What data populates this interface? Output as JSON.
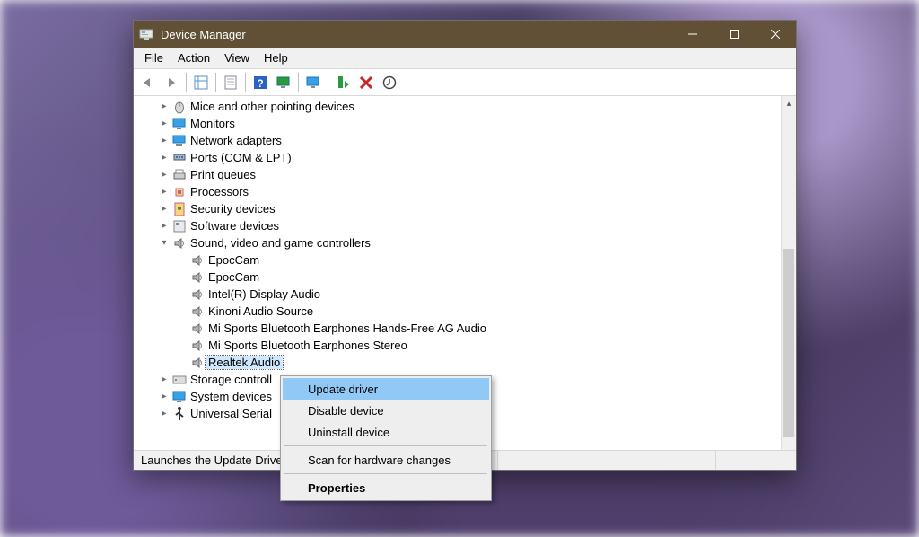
{
  "window": {
    "title": "Device Manager"
  },
  "menubar": [
    "File",
    "Action",
    "View",
    "Help"
  ],
  "toolbar_icons": [
    "back",
    "forward",
    "show-hidden",
    "properties-sheet",
    "help",
    "monitor-scan",
    "monitor-app",
    "enable-device",
    "remove-device",
    "update-driver"
  ],
  "tree": {
    "top_level": [
      {
        "label": "Mice and other pointing devices",
        "icon": "mouse",
        "chev": ">"
      },
      {
        "label": "Monitors",
        "icon": "monitor",
        "chev": ">"
      },
      {
        "label": "Network adapters",
        "icon": "network",
        "chev": ">"
      },
      {
        "label": "Ports (COM & LPT)",
        "icon": "port",
        "chev": ">"
      },
      {
        "label": "Print queues",
        "icon": "printer",
        "chev": ">"
      },
      {
        "label": "Processors",
        "icon": "cpu",
        "chev": ">"
      },
      {
        "label": "Security devices",
        "icon": "security",
        "chev": ">"
      },
      {
        "label": "Software devices",
        "icon": "software",
        "chev": ">"
      },
      {
        "label": "Sound, video and game controllers",
        "icon": "sound",
        "chev": "v",
        "children": [
          "EpocCam",
          "EpocCam",
          "Intel(R) Display Audio",
          "Kinoni Audio Source",
          "Mi Sports Bluetooth Earphones Hands-Free AG Audio",
          "Mi Sports Bluetooth Earphones Stereo",
          "Realtek Audio"
        ],
        "selected_child_index": 6
      },
      {
        "label": "Storage controll",
        "icon": "storage",
        "chev": ">"
      },
      {
        "label": "System devices",
        "icon": "system",
        "chev": ">"
      },
      {
        "label": "Universal Serial",
        "icon": "usb",
        "chev": ">"
      }
    ]
  },
  "context_menu": {
    "items": [
      "Update driver",
      "Disable device",
      "Uninstall device",
      "Scan for hardware changes",
      "Properties"
    ],
    "highlighted_index": 0,
    "bold_index": 4
  },
  "statusbar": {
    "text": "Launches the Update Driver"
  }
}
